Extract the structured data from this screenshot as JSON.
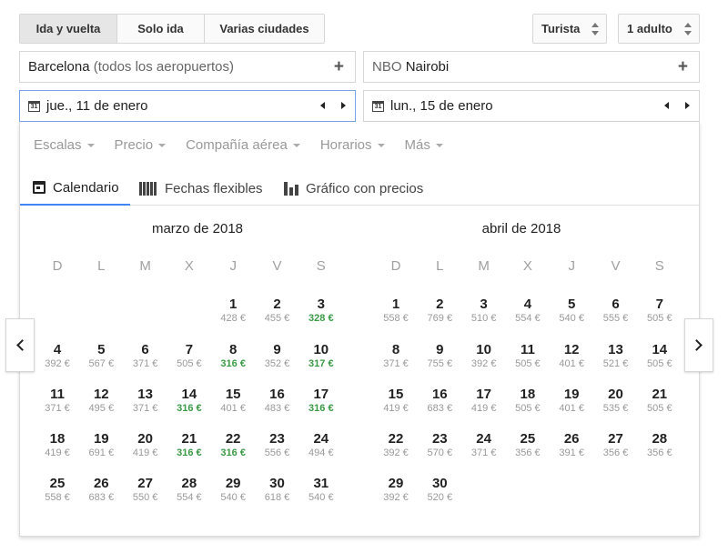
{
  "trip_type": {
    "options": [
      "Ida y vuelta",
      "Solo ida",
      "Varias ciudades"
    ],
    "selected": "Ida y vuelta"
  },
  "cabin_class": "Turista",
  "passengers": "1 adulto",
  "origin": {
    "city": "Barcelona",
    "detail": "(todos los aeropuertos)"
  },
  "destination": {
    "code": "NBO",
    "city": "Nairobi"
  },
  "depart_date": "jue., 11 de enero",
  "return_date": "lun., 15 de enero",
  "calendar_icon_text": "31",
  "filters": [
    "Escalas",
    "Precio",
    "Compañía aérea",
    "Horarios",
    "Más"
  ],
  "view_tabs": {
    "calendar": "Calendario",
    "flexible": "Fechas flexibles",
    "price_graph": "Gráfico con precios",
    "selected": "Calendario"
  },
  "weekdays": [
    "D",
    "L",
    "M",
    "X",
    "J",
    "V",
    "S"
  ],
  "colors": {
    "accent": "#4285f4",
    "low_price": "#3a9a46",
    "focus_border": "#7aa4e8"
  },
  "months": [
    {
      "title": "marzo de 2018",
      "first_weekday": 4,
      "days": [
        {
          "d": "1",
          "p": "428 €"
        },
        {
          "d": "2",
          "p": "455 €"
        },
        {
          "d": "3",
          "p": "328 €",
          "low": true
        },
        {
          "d": "4",
          "p": "392 €"
        },
        {
          "d": "5",
          "p": "567 €"
        },
        {
          "d": "6",
          "p": "371 €"
        },
        {
          "d": "7",
          "p": "505 €"
        },
        {
          "d": "8",
          "p": "316 €",
          "low": true
        },
        {
          "d": "9",
          "p": "352 €"
        },
        {
          "d": "10",
          "p": "317 €",
          "low": true
        },
        {
          "d": "11",
          "p": "371 €"
        },
        {
          "d": "12",
          "p": "495 €"
        },
        {
          "d": "13",
          "p": "371 €"
        },
        {
          "d": "14",
          "p": "316 €",
          "low": true
        },
        {
          "d": "15",
          "p": "401 €"
        },
        {
          "d": "16",
          "p": "483 €"
        },
        {
          "d": "17",
          "p": "316 €",
          "low": true
        },
        {
          "d": "18",
          "p": "419 €"
        },
        {
          "d": "19",
          "p": "691 €"
        },
        {
          "d": "20",
          "p": "419 €"
        },
        {
          "d": "21",
          "p": "316 €",
          "low": true
        },
        {
          "d": "22",
          "p": "316 €",
          "low": true
        },
        {
          "d": "23",
          "p": "556 €"
        },
        {
          "d": "24",
          "p": "494 €"
        },
        {
          "d": "25",
          "p": "558 €"
        },
        {
          "d": "26",
          "p": "683 €"
        },
        {
          "d": "27",
          "p": "550 €"
        },
        {
          "d": "28",
          "p": "554 €"
        },
        {
          "d": "29",
          "p": "540 €"
        },
        {
          "d": "30",
          "p": "618 €"
        },
        {
          "d": "31",
          "p": "540 €"
        }
      ]
    },
    {
      "title": "abril de 2018",
      "first_weekday": 0,
      "days": [
        {
          "d": "1",
          "p": "558 €"
        },
        {
          "d": "2",
          "p": "769 €"
        },
        {
          "d": "3",
          "p": "510 €"
        },
        {
          "d": "4",
          "p": "554 €"
        },
        {
          "d": "5",
          "p": "540 €"
        },
        {
          "d": "6",
          "p": "555 €"
        },
        {
          "d": "7",
          "p": "505 €"
        },
        {
          "d": "8",
          "p": "371 €"
        },
        {
          "d": "9",
          "p": "755 €"
        },
        {
          "d": "10",
          "p": "392 €"
        },
        {
          "d": "11",
          "p": "505 €"
        },
        {
          "d": "12",
          "p": "401 €"
        },
        {
          "d": "13",
          "p": "521 €"
        },
        {
          "d": "14",
          "p": "505 €"
        },
        {
          "d": "15",
          "p": "419 €"
        },
        {
          "d": "16",
          "p": "683 €"
        },
        {
          "d": "17",
          "p": "419 €"
        },
        {
          "d": "18",
          "p": "505 €"
        },
        {
          "d": "19",
          "p": "401 €"
        },
        {
          "d": "20",
          "p": "535 €"
        },
        {
          "d": "21",
          "p": "505 €"
        },
        {
          "d": "22",
          "p": "392 €"
        },
        {
          "d": "23",
          "p": "570 €"
        },
        {
          "d": "24",
          "p": "371 €"
        },
        {
          "d": "25",
          "p": "356 €"
        },
        {
          "d": "26",
          "p": "391 €"
        },
        {
          "d": "27",
          "p": "356 €"
        },
        {
          "d": "28",
          "p": "356 €"
        },
        {
          "d": "29",
          "p": "392 €"
        },
        {
          "d": "30",
          "p": "520 €"
        }
      ]
    }
  ]
}
